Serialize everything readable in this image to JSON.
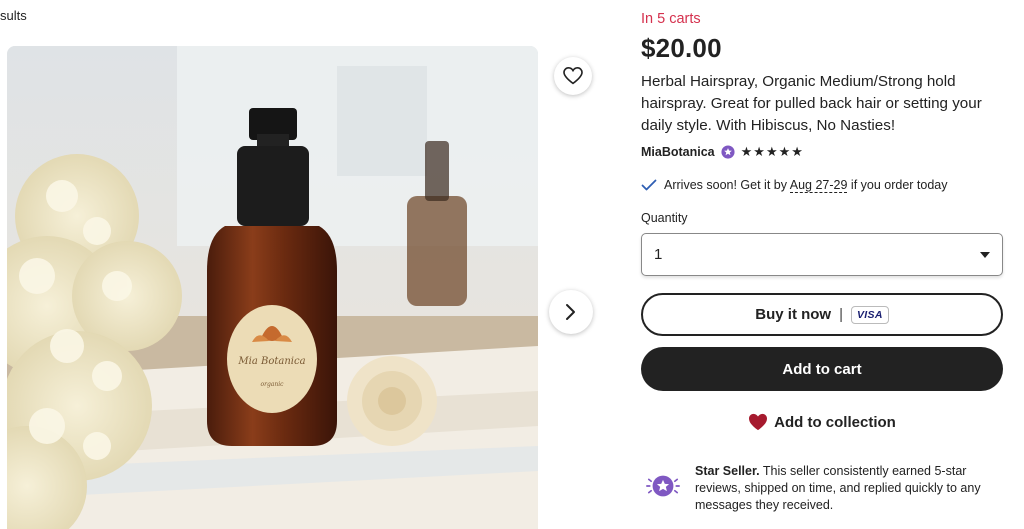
{
  "breadcrumb": "sults",
  "listing": {
    "in_carts": "In 5 carts",
    "price": "$20.00",
    "title": "Herbal Hairspray, Organic Medium/Strong hold hairspray. Great for pulled back hair or setting your daily style. With Hibiscus, No Nasties!",
    "seller": "MiaBotanica",
    "rating_stars": 5,
    "stars_text": "★★★★★"
  },
  "shipping": {
    "prefix": "Arrives soon! Get it by ",
    "date": "Aug 27-29",
    "suffix": " if you order today"
  },
  "quantity": {
    "label": "Quantity",
    "selected": "1"
  },
  "buttons": {
    "buy_now": "Buy it now",
    "separator": "|",
    "visa": "VISA",
    "add_to_cart": "Add to cart",
    "add_to_collection": "Add to collection"
  },
  "star_seller": {
    "title": "Star Seller.",
    "text": " This seller consistently earned 5-star reviews, shipped on time, and replied quickly to any messages they received."
  },
  "product_label": {
    "brand": "Mia Botanica",
    "sub": "organic"
  },
  "colors": {
    "accent_red": "#d5314e",
    "star_purple": "#7f58c2",
    "heart_red": "#a61a2e"
  },
  "icons": [
    "heart-outline-icon",
    "chevron-right-icon",
    "star-seller-badge-icon",
    "checkmark-icon",
    "caret-down-icon",
    "heart-filled-icon"
  ]
}
